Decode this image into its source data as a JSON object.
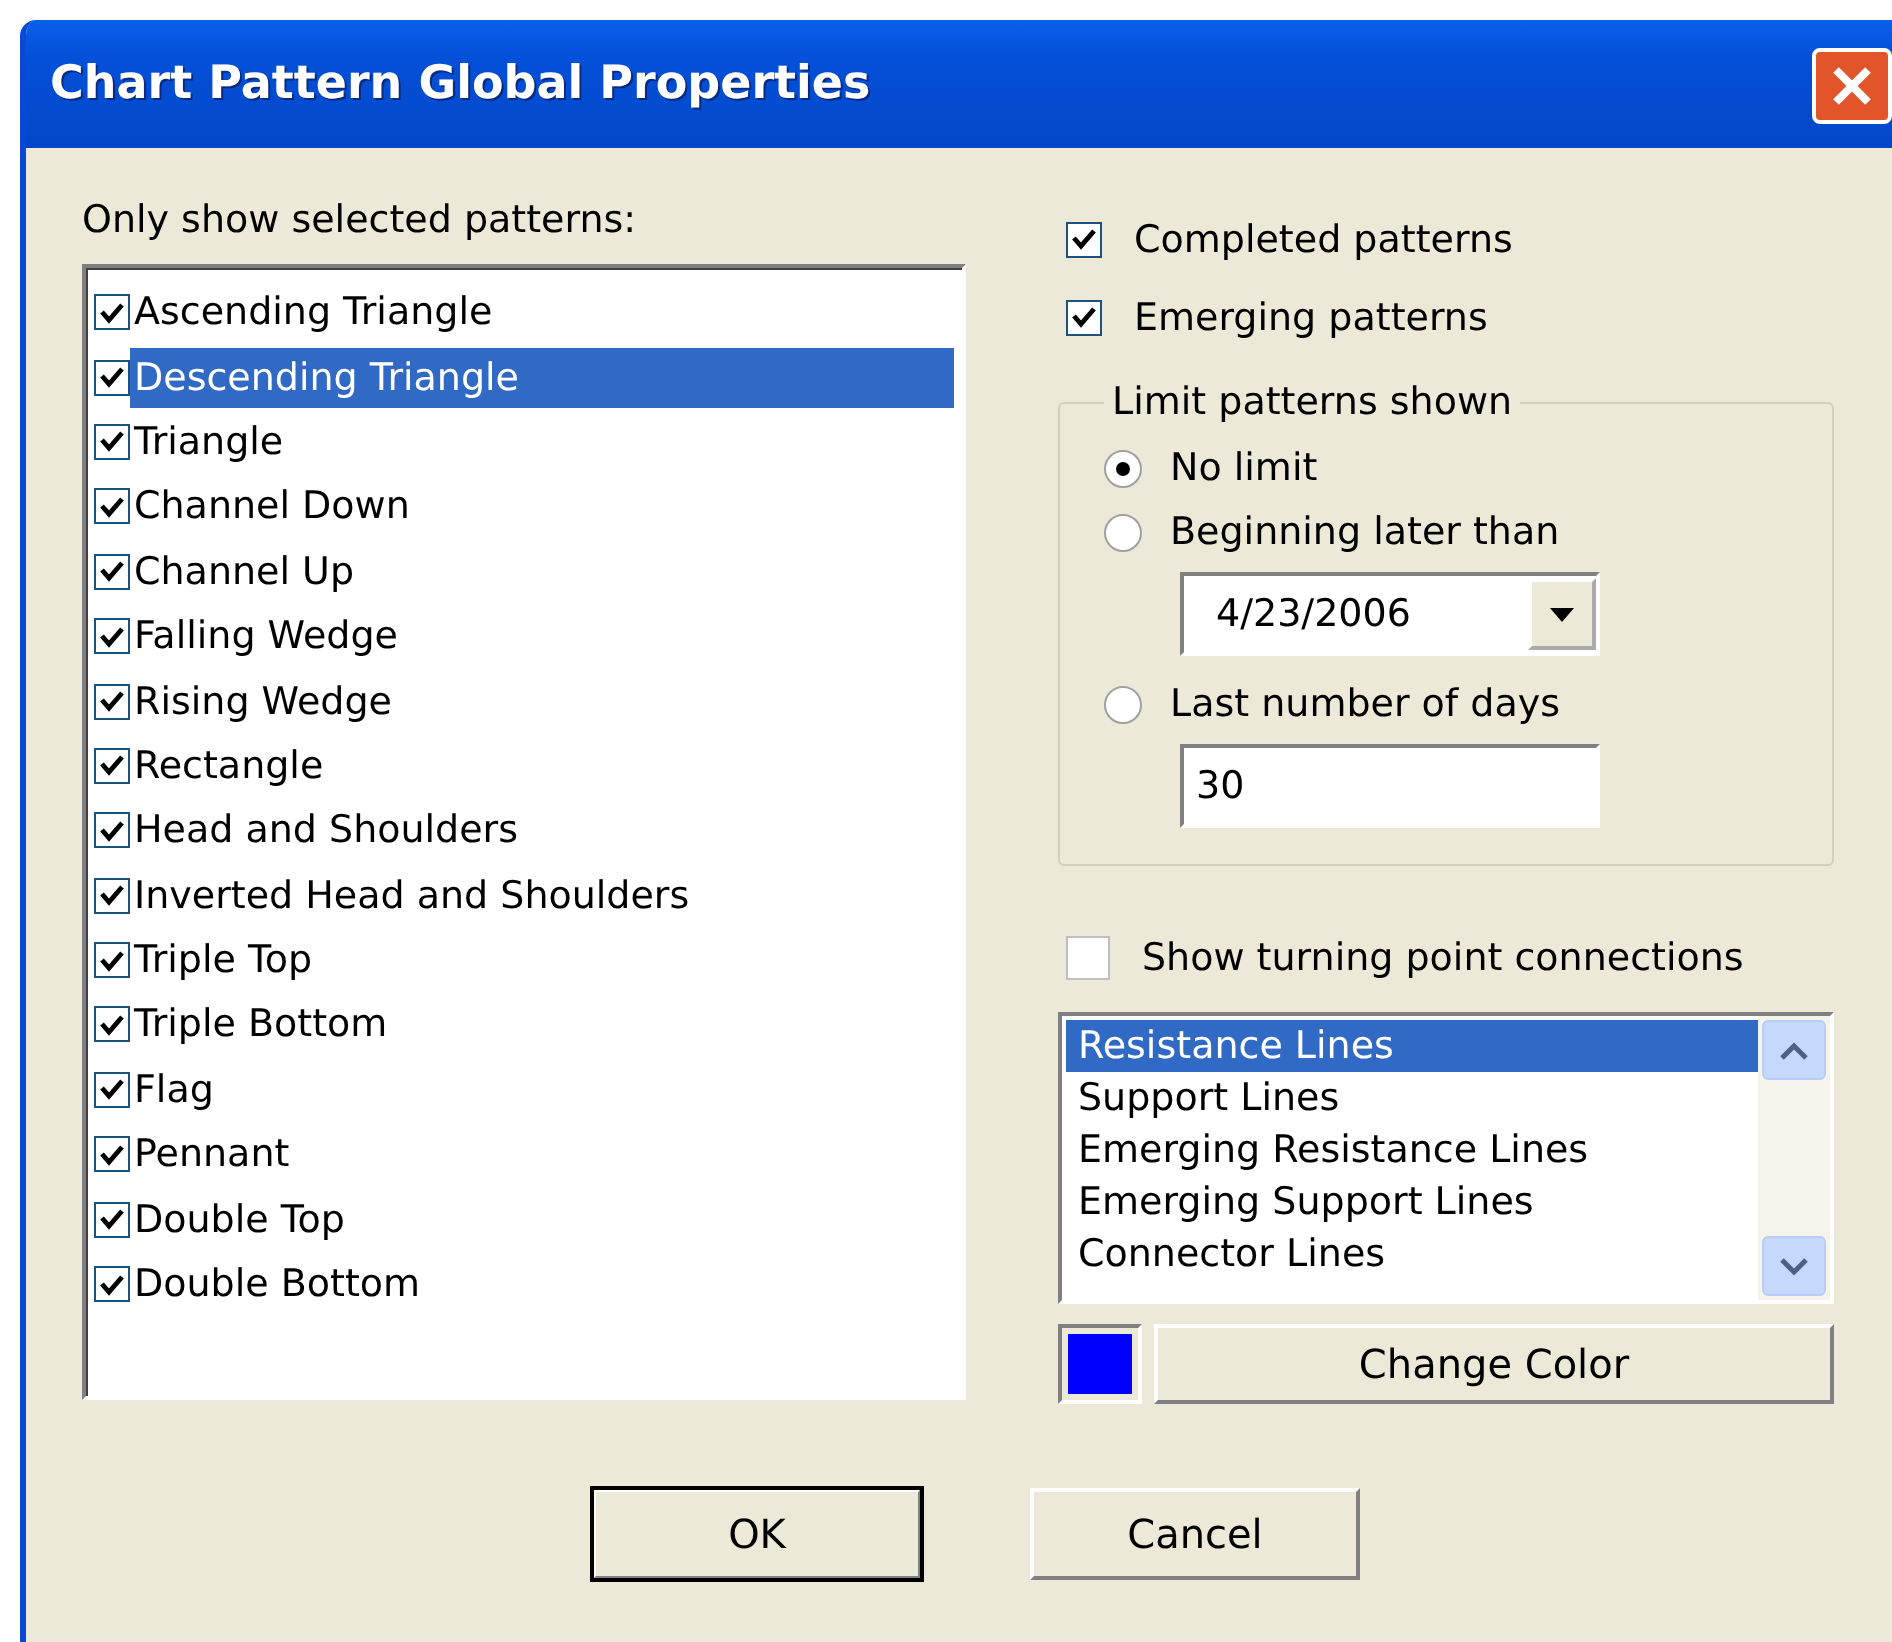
{
  "window": {
    "title": "Chart Pattern Global Properties"
  },
  "patterns": {
    "label": "Only show selected patterns:",
    "items": [
      {
        "label": "Ascending Triangle",
        "checked": true,
        "selected": false
      },
      {
        "label": "Descending Triangle",
        "checked": true,
        "selected": true
      },
      {
        "label": "Triangle",
        "checked": true,
        "selected": false
      },
      {
        "label": "Channel Down",
        "checked": true,
        "selected": false
      },
      {
        "label": "Channel Up",
        "checked": true,
        "selected": false
      },
      {
        "label": "Falling Wedge",
        "checked": true,
        "selected": false
      },
      {
        "label": "Rising Wedge",
        "checked": true,
        "selected": false
      },
      {
        "label": "Rectangle",
        "checked": true,
        "selected": false
      },
      {
        "label": "Head and Shoulders",
        "checked": true,
        "selected": false
      },
      {
        "label": "Inverted Head and Shoulders",
        "checked": true,
        "selected": false
      },
      {
        "label": "Triple Top",
        "checked": true,
        "selected": false
      },
      {
        "label": "Triple Bottom",
        "checked": true,
        "selected": false
      },
      {
        "label": "Flag",
        "checked": true,
        "selected": false
      },
      {
        "label": "Pennant",
        "checked": true,
        "selected": false
      },
      {
        "label": "Double Top",
        "checked": true,
        "selected": false
      },
      {
        "label": "Double Bottom",
        "checked": true,
        "selected": false
      }
    ]
  },
  "options": [
    {
      "label": "Completed patterns",
      "checked": true
    },
    {
      "label": "Emerging patterns",
      "checked": true
    }
  ],
  "limit": {
    "title": "Limit patterns shown",
    "choices": [
      {
        "label": "No limit",
        "selected": true
      },
      {
        "label": "Beginning later than",
        "selected": false,
        "date": "4/23/2006"
      },
      {
        "label": "Last number of days",
        "selected": false,
        "value": "30"
      }
    ]
  },
  "turning": {
    "label": "Show turning point connections",
    "checked": false,
    "lines": [
      {
        "label": "Resistance Lines",
        "selected": true
      },
      {
        "label": "Support Lines",
        "selected": false
      },
      {
        "label": "Emerging Resistance Lines",
        "selected": false
      },
      {
        "label": "Emerging Support Lines",
        "selected": false
      },
      {
        "label": "Connector Lines",
        "selected": false
      }
    ],
    "color": "#0000ff",
    "button": "Change Color"
  },
  "buttons": [
    {
      "label": "OK",
      "default": true
    },
    {
      "label": "Cancel",
      "default": false
    }
  ]
}
